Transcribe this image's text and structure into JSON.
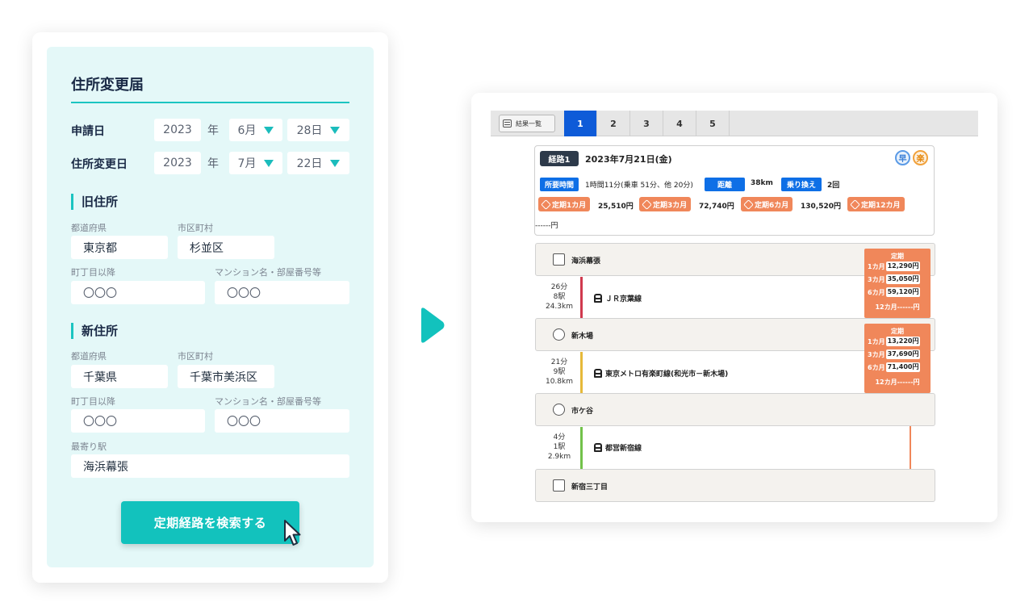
{
  "form": {
    "title": "住所変更届",
    "apply_date": {
      "label": "申請日",
      "year": "2023",
      "nen": "年",
      "month": "6月",
      "day": "28日"
    },
    "change_date": {
      "label": "住所変更日",
      "year": "2023",
      "nen": "年",
      "month": "7月",
      "day": "22日"
    },
    "old_address": {
      "heading": "旧住所",
      "pref_label": "都道府県",
      "pref": "東京都",
      "city_label": "市区町村",
      "city": "杉並区",
      "town_label": "町丁目以降",
      "town": "〇〇〇",
      "building_label": "マンション名・部屋番号等",
      "building": "〇〇〇"
    },
    "new_address": {
      "heading": "新住所",
      "pref_label": "都道府県",
      "pref": "千葉県",
      "city_label": "市区町村",
      "city": "千葉市美浜区",
      "town_label": "町丁目以降",
      "town": "〇〇〇",
      "building_label": "マンション名・部屋番号等",
      "building": "〇〇〇",
      "station_label": "最寄り駅",
      "station": "海浜幕張"
    },
    "search_button": "定期経路を検索する"
  },
  "results": {
    "list_button": "結果一覧",
    "tabs": [
      "1",
      "2",
      "3",
      "4",
      "5"
    ],
    "active_tab": "1",
    "summary": {
      "route_label": "経路1",
      "date": "2023年7月21日(金)",
      "badge_fast": "早",
      "badge_easy": "楽",
      "time_label": "所要時間",
      "time_value": "1時間11分(乗車 51分、他 20分)",
      "distance_label": "距離",
      "distance_value": "38km",
      "transfer_label": "乗り換え",
      "transfer_value": "2回",
      "passes": [
        {
          "label": "定期1カ月",
          "price": "25,510円"
        },
        {
          "label": "定期3カ月",
          "price": "72,740円"
        },
        {
          "label": "定期6カ月",
          "price": "130,520円"
        },
        {
          "label": "定期12カ月",
          "price": "------円"
        }
      ]
    },
    "stations": [
      "海浜幕張",
      "新木場",
      "市ケ谷",
      "新宿三丁目"
    ],
    "segments": [
      {
        "time": "26分",
        "stops": "8駅",
        "distance": "24.3km",
        "line": "ＪＲ京葉線",
        "color": "#d03a4e"
      },
      {
        "time": "21分",
        "stops": "9駅",
        "distance": "10.8km",
        "line": "東京メトロ有楽町線(和光市－新木場)",
        "color": "#e6b93a"
      },
      {
        "time": "4分",
        "stops": "1駅",
        "distance": "2.9km",
        "line": "都営新宿線",
        "color": "#72c24a"
      }
    ],
    "pass_boxes": [
      {
        "title": "定期",
        "rows": [
          {
            "term": "1カ月",
            "price": "12,290円"
          },
          {
            "term": "3カ月",
            "price": "35,050円"
          },
          {
            "term": "6カ月",
            "price": "59,120円"
          }
        ],
        "twelve": "12カ月------円"
      },
      {
        "title": "定期",
        "rows": [
          {
            "term": "1カ月",
            "price": "13,220円"
          },
          {
            "term": "3カ月",
            "price": "37,690円"
          },
          {
            "term": "6カ月",
            "price": "71,400円"
          }
        ],
        "twelve": "12カ月------円"
      }
    ],
    "colors": {
      "accent": "#12c2bd",
      "tab_active": "#0e5bd8",
      "pass": "#f0875a"
    }
  }
}
